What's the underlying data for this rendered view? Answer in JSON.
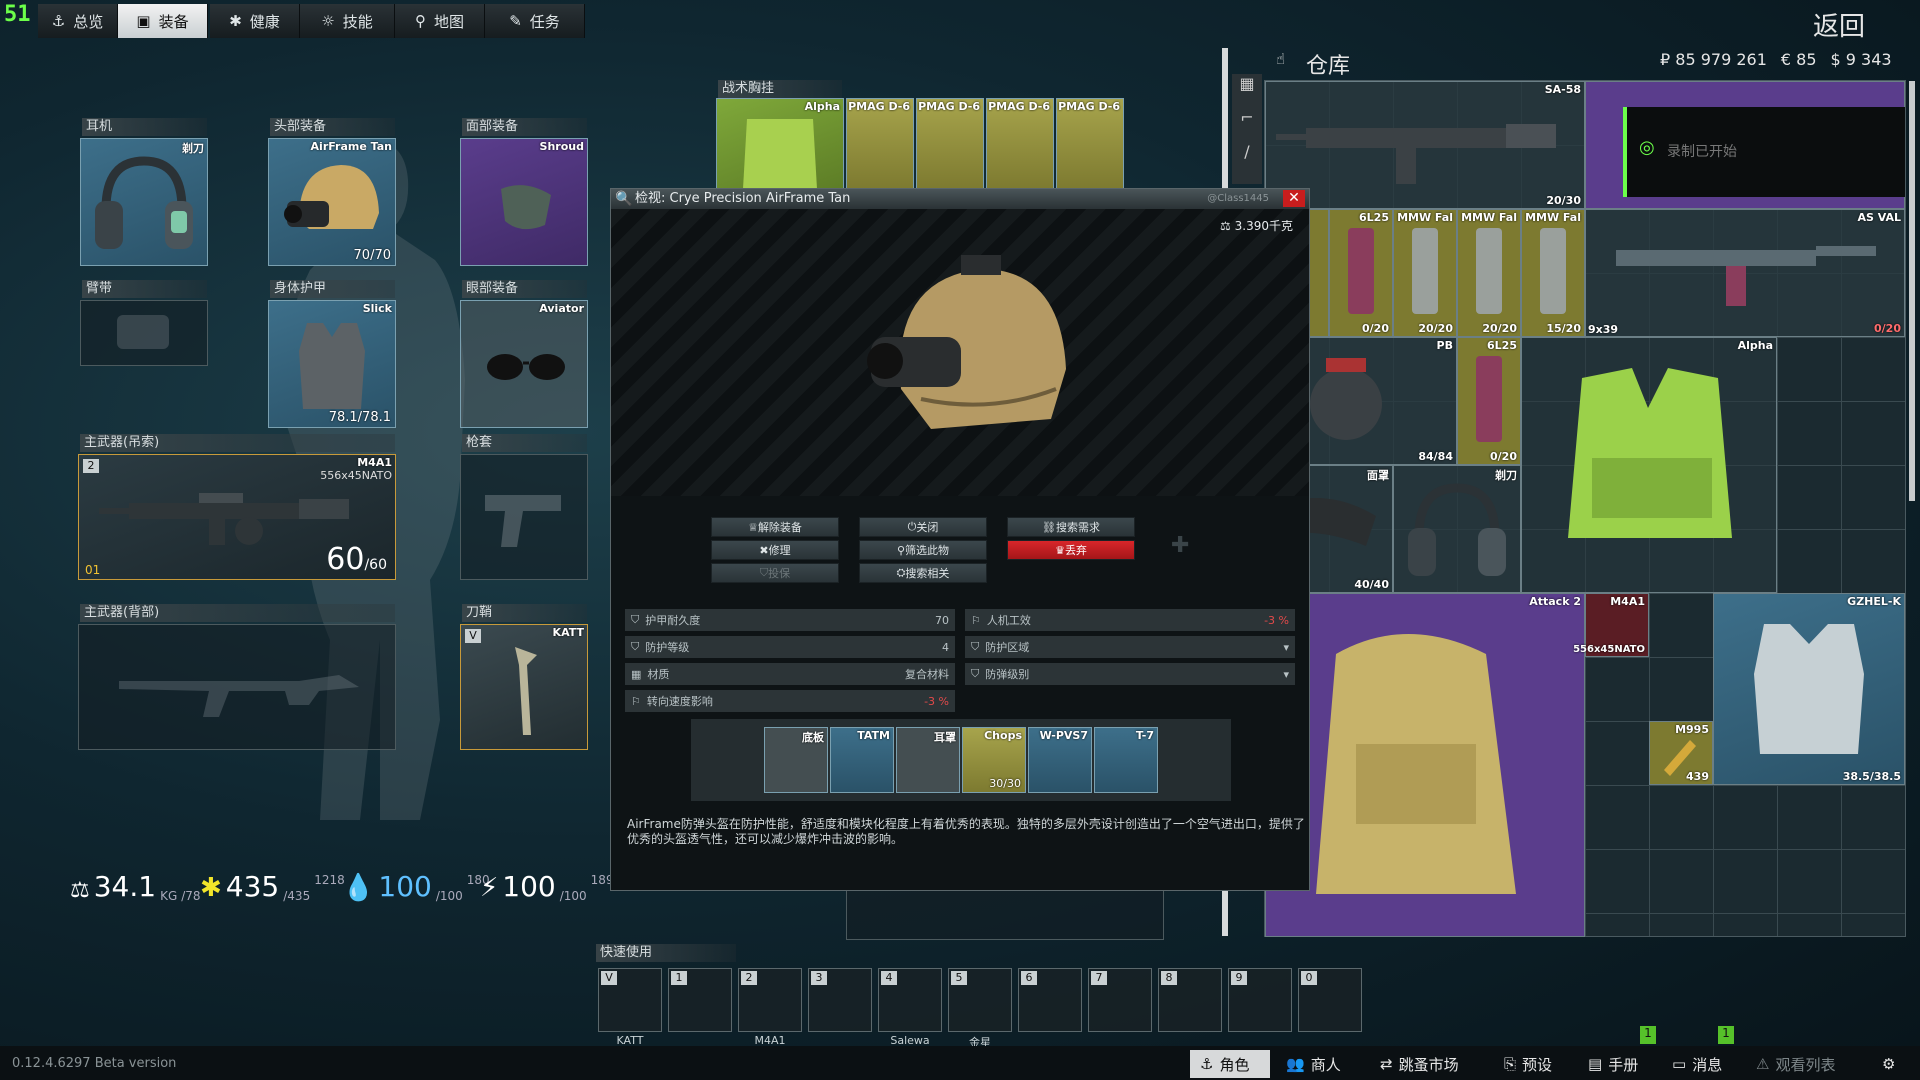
{
  "fps": "51",
  "nav": {
    "tabs": [
      {
        "label": "总览",
        "icon": "anchor-icon"
      },
      {
        "label": "装备",
        "icon": "gear-equipment-icon"
      },
      {
        "label": "健康",
        "icon": "health-icon"
      },
      {
        "label": "技能",
        "icon": "skills-icon"
      },
      {
        "label": "地图",
        "icon": "map-pin-icon"
      },
      {
        "label": "任务",
        "icon": "tasks-icon"
      }
    ],
    "active_index": 1,
    "back_label": "返回"
  },
  "equipment": {
    "slots": {
      "earpiece": {
        "label": "耳机",
        "item": "剃刀"
      },
      "headwear": {
        "label": "头部装备",
        "item": "AirFrame Tan",
        "durability": "70/70"
      },
      "face_cover": {
        "label": "面部装备",
        "item": "Shroud"
      },
      "armband": {
        "label": "臂带"
      },
      "body_armor": {
        "label": "身体护甲",
        "item": "Slick",
        "durability": "78.1/78.1"
      },
      "eyewear": {
        "label": "眼部装备",
        "item": "Aviator"
      },
      "primary_sling": {
        "label": "主武器(吊索)",
        "item": "M4A1",
        "ammo_type": "556x45NATO",
        "ammo": "60",
        "ammo_max": "/60",
        "slot_key": "2",
        "rank": "01"
      },
      "holster": {
        "label": "枪套"
      },
      "primary_back": {
        "label": "主武器(背部)"
      },
      "scabbard": {
        "label": "刀鞘",
        "item": "KATT",
        "slot_key": "V"
      },
      "tactical_rig": {
        "label": "战术胸挂",
        "item": "Alpha",
        "mags": [
          "PMAG D-6",
          "PMAG D-6",
          "PMAG D-6",
          "PMAG D-6"
        ]
      }
    }
  },
  "stats": {
    "weight": {
      "value": "34.1",
      "unit": "KG",
      "max": "/78"
    },
    "energy": {
      "value": "435",
      "max": "/435",
      "delta": "1218"
    },
    "hydration": {
      "value": "100",
      "max": "/100",
      "delta": "180"
    },
    "stamina": {
      "value": "100",
      "max": "/100",
      "delta": "189"
    }
  },
  "inspect": {
    "title": "检视: Crye Precision AirFrame Tan",
    "class_tag": "@Class1445",
    "weight": "3.390千克",
    "actions": {
      "unequip": "解除装备",
      "close": "关闭",
      "search_need": "搜索需求",
      "repair": "修理",
      "filter": "筛选此物",
      "discard": "丢弃",
      "insure": "投保",
      "search_related": "搜索相关"
    },
    "props": {
      "armor_durability_label": "护甲耐久度",
      "armor_durability_value": "70",
      "ergo_label": "人机工效",
      "ergo_value": "-3 %",
      "armor_class_label": "防护等级",
      "armor_class_value": "4",
      "zones_label": "防护区域",
      "material_label": "材质",
      "material_value": "复合材料",
      "armor_type_label": "防弹级别",
      "turn_speed_label": "转向速度影响",
      "turn_speed_value": "-3 %"
    },
    "mods": [
      {
        "name": "底板"
      },
      {
        "name": "TATM"
      },
      {
        "name": "耳罩"
      },
      {
        "name": "Chops",
        "count": "30/30"
      },
      {
        "name": "W-PVS7"
      },
      {
        "name": "T-7"
      }
    ],
    "description": "AirFrame防弹头盔在防护性能，舒适度和模块化程度上有着优秀的表现。独特的多层外壳设计创造出了一个空气进出口，提供了优秀的头盔透气性，还可以减少爆炸冲击波的影响。"
  },
  "stash": {
    "title": "仓库",
    "currency": {
      "rub": "₽ 85 979 261",
      "eur": "€ 85",
      "usd": "$ 9 343"
    },
    "recording_text": "录制已开始",
    "items": [
      {
        "name": "SA-58",
        "count": "20/30"
      },
      {
        "name": "AS VAL",
        "count": "0/20"
      },
      {
        "name": "6L25",
        "count": "0/20"
      },
      {
        "name": "MMW Fal",
        "count": "20/20"
      },
      {
        "name": "MMW Fal",
        "count": "20/20"
      },
      {
        "name": "MMW Fal",
        "count": "15/20"
      },
      {
        "name": "9x39"
      },
      {
        "name": "PB",
        "count": "84/84"
      },
      {
        "name": "6L25",
        "count": "0/20"
      },
      {
        "name": "Alpha"
      },
      {
        "name": "面罩",
        "count": "40/40"
      },
      {
        "name": "剃刀"
      },
      {
        "name": "Attack 2"
      },
      {
        "name": "M4A1",
        "count": "556x45NATO"
      },
      {
        "name": "GZHEL-K",
        "count": "38.5/38.5"
      },
      {
        "name": "M995",
        "count": "439"
      }
    ]
  },
  "quickbar": {
    "label": "快速使用",
    "slots": [
      {
        "key": "V",
        "item": "KATT"
      },
      {
        "key": "1",
        "item": ""
      },
      {
        "key": "2",
        "item": "M4A1"
      },
      {
        "key": "3",
        "item": ""
      },
      {
        "key": "4",
        "item": "Salewa"
      },
      {
        "key": "5",
        "item": "金星"
      },
      {
        "key": "6",
        "item": ""
      },
      {
        "key": "7",
        "item": ""
      },
      {
        "key": "8",
        "item": ""
      },
      {
        "key": "9",
        "item": ""
      },
      {
        "key": "0",
        "item": ""
      }
    ]
  },
  "bottom": {
    "version": "0.12.4.6297 Beta version",
    "buttons": [
      "角色",
      "商人",
      "跳蚤市场",
      "预设",
      "手册",
      "消息",
      "观看列表"
    ],
    "badges": [
      "1",
      "1"
    ]
  },
  "colors": {
    "accent_green": "#6cff4a",
    "danger_red": "#c81d1d",
    "ammo_purple": "#5a3d8c",
    "rig_green": "#7fa83a"
  }
}
